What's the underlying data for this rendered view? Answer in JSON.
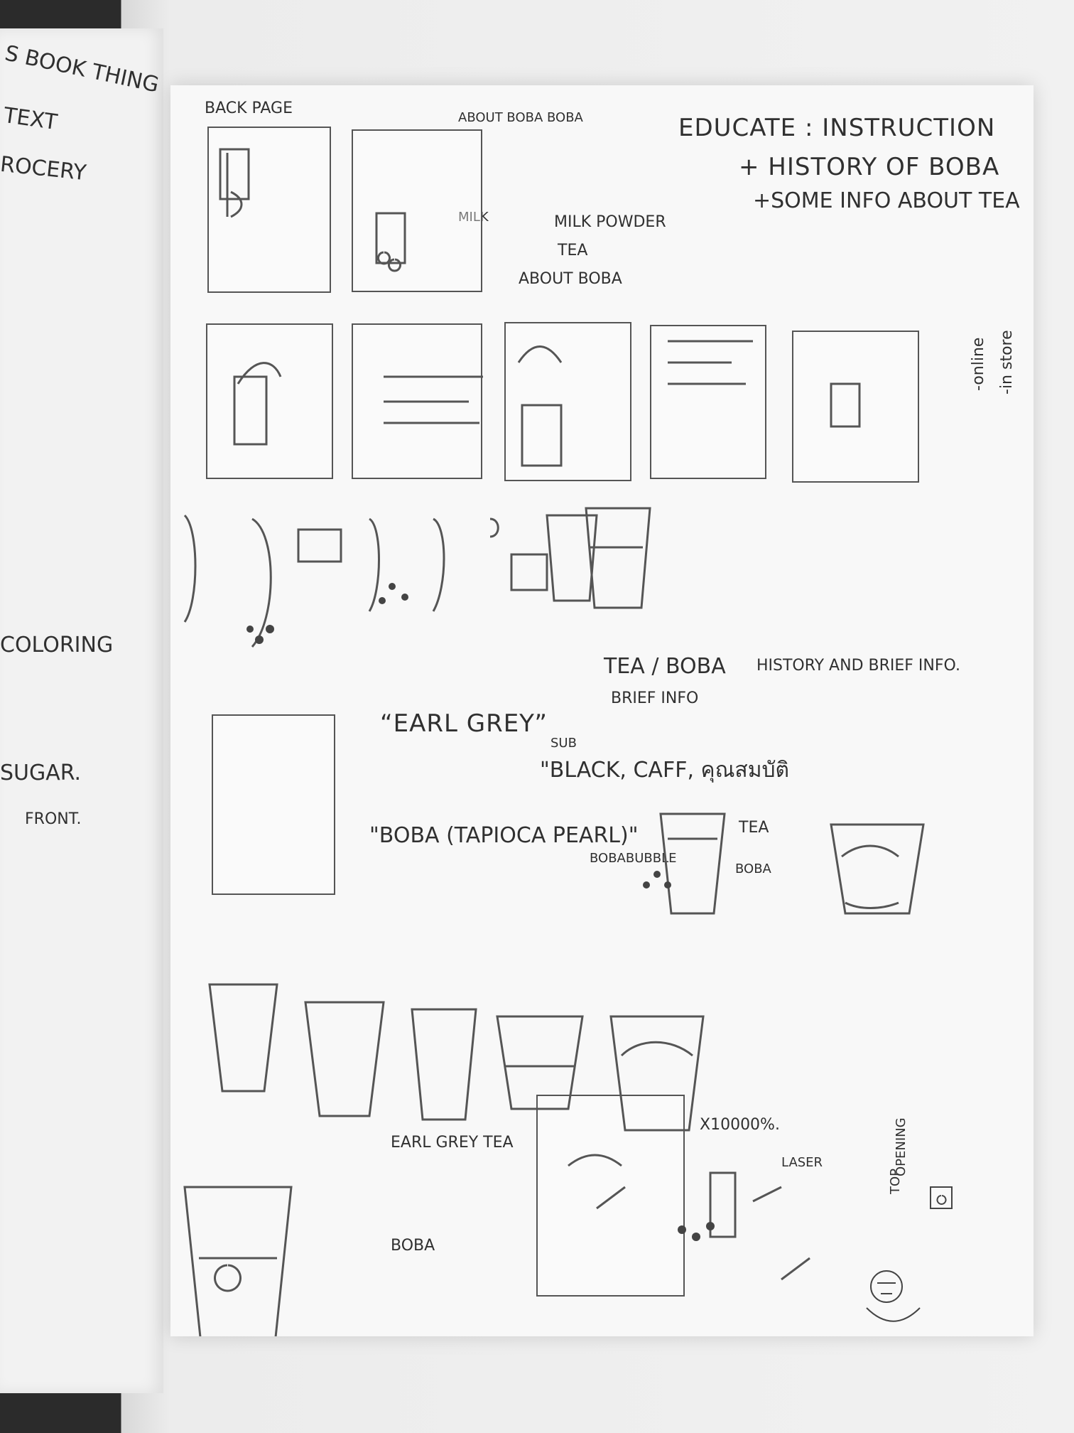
{
  "left_page": {
    "book_thing": "S BOOK THING",
    "text": "TEXT",
    "grocery": "ROCERY",
    "coloring": "COLORING",
    "sugar": "SUGAR.",
    "front": "FRONT."
  },
  "right_page": {
    "back_page": "BACK PAGE",
    "about_boba": "ABOUT BOBA BOBA",
    "educate_instruction": "EDUCATE : INSTRUCTION",
    "history_of_boba": "+ HISTORY OF BOBA",
    "some_info_tea": "+SOME INFO ABOUT TEA",
    "milk_powder": "MILK POWDER",
    "tea_arrow": "TEA",
    "about_boba_arrow": "ABOUT BOBA",
    "tea_boba_title": "TEA / BOBA",
    "history_brief": "HISTORY AND BRIEF INFO.",
    "brief_info": "BRIEF INFO",
    "earl_grey_quote": "“EARL GREY”",
    "sub": "SUB",
    "black_caff": "\"BLACK, CAFF, คุณสมบัติ",
    "boba_tapioca": "\"BOBA (TAPIOCA PEARL)\"",
    "tea_label": "TEA",
    "boba_label": "BOBA",
    "earl_grey_tea": "EARL GREY TEA",
    "boba_bottom": "BOBA",
    "x10000": "X10000%.",
    "laser": "LASER",
    "milk_label": "MILK",
    "online": "-online",
    "instore": "-in store",
    "opening": "OPENING",
    "top": "TOP",
    "bobabubble": "BOBABUBBLE"
  }
}
